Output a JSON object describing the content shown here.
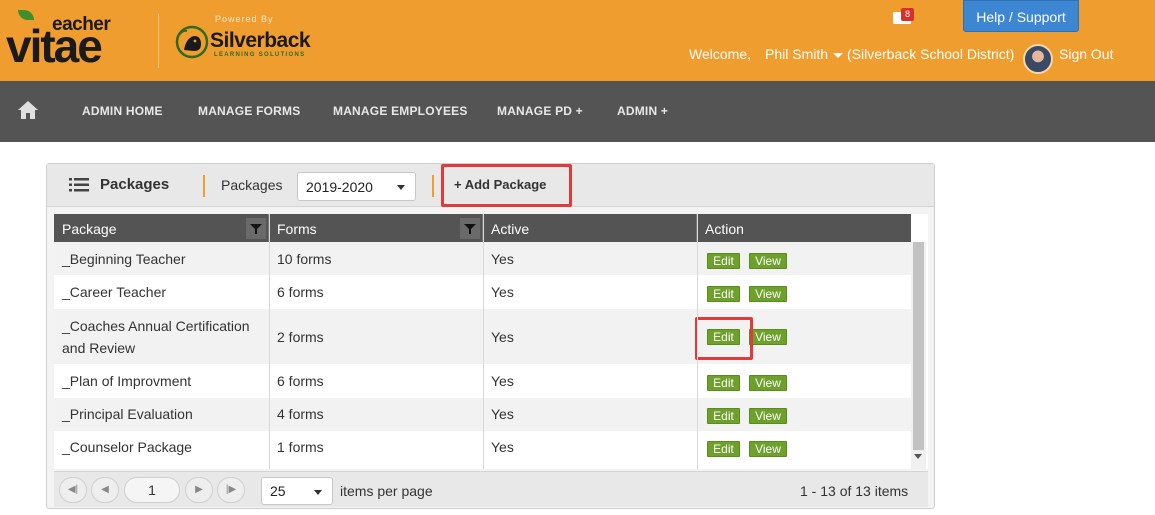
{
  "header": {
    "logo_word": "vitae",
    "logo_small": "eacher",
    "powered_by": "Powered By",
    "partner_name": "Silverback",
    "partner_sub": "LEARNING SOLUTIONS",
    "mail_count": "8",
    "help_label": "Help / Support",
    "welcome": "Welcome,",
    "user_name": "Phil Smith",
    "district": "(Silverback School District)",
    "sign_out": "Sign Out"
  },
  "nav": {
    "items": [
      "ADMIN HOME",
      "MANAGE FORMS",
      "MANAGE EMPLOYEES",
      "MANAGE PD +",
      "ADMIN +"
    ]
  },
  "panel": {
    "title": "Packages",
    "packages_label": "Packages",
    "year_selected": "2019-2020",
    "add_package": "+ Add Package"
  },
  "grid": {
    "columns": [
      "Package",
      "Forms",
      "Active",
      "Action"
    ],
    "rows": [
      {
        "package": "_Beginning Teacher",
        "forms": "10 forms",
        "active": "Yes"
      },
      {
        "package": "_Career Teacher",
        "forms": "6 forms",
        "active": "Yes"
      },
      {
        "package": "_Coaches Annual Certification and Review",
        "forms": "2 forms",
        "active": "Yes"
      },
      {
        "package": "_Plan of Improvment",
        "forms": "6 forms",
        "active": "Yes"
      },
      {
        "package": "_Principal Evaluation",
        "forms": "4 forms",
        "active": "Yes"
      },
      {
        "package": "_Counselor Package",
        "forms": "1 forms",
        "active": "Yes"
      }
    ],
    "edit_label": "Edit",
    "view_label": "View"
  },
  "pager": {
    "current_page": "1",
    "page_size": "25",
    "items_per_page_label": "items per page",
    "count_text": "1 - 13 of 13 items"
  },
  "colors": {
    "header": "#f09d2f",
    "nav": "#545454",
    "button_green": "#6ea12c",
    "highlight": "#e03a3a"
  }
}
